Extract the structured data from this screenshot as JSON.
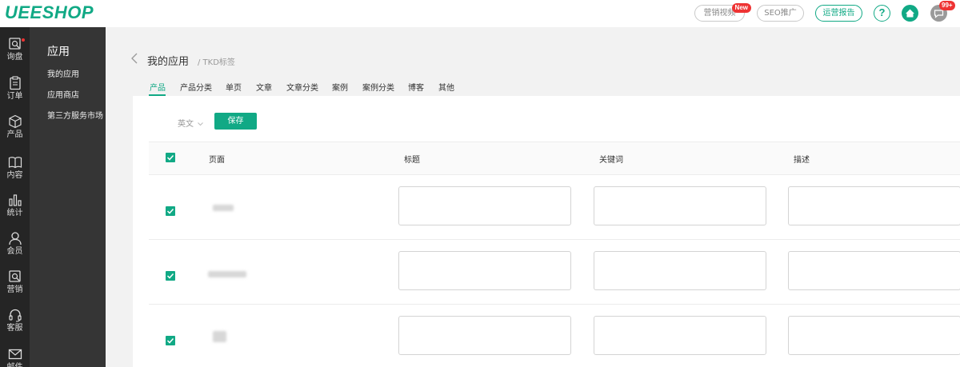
{
  "app": {
    "logo": "UEESHOP"
  },
  "topbar": {
    "marketing_video": "营销视频",
    "new_badge": "New",
    "seo": "SEO推广",
    "ops_report": "运营报告",
    "help": "?",
    "msg_count": "99+"
  },
  "sidebar": {
    "items": [
      {
        "label": "询盘",
        "icon": "inquiry-icon"
      },
      {
        "label": "订单",
        "icon": "order-icon"
      },
      {
        "label": "产品",
        "icon": "product-cube-icon"
      },
      {
        "label": "内容",
        "icon": "content-book-icon"
      },
      {
        "label": "统计",
        "icon": "stats-bar-icon"
      },
      {
        "label": "会员",
        "icon": "member-person-icon"
      },
      {
        "label": "营销",
        "icon": "marketing-icon"
      },
      {
        "label": "客服",
        "icon": "headset-icon"
      },
      {
        "label": "邮件",
        "icon": "mail-icon"
      }
    ]
  },
  "subnav": {
    "title": "应用",
    "items": [
      "我的应用",
      "应用商店",
      "第三方服务市场"
    ]
  },
  "page": {
    "title": "我的应用",
    "breadcrumb": "/ TKD标签"
  },
  "tabs": [
    "产品",
    "产品分类",
    "单页",
    "文章",
    "文章分类",
    "案例",
    "案例分类",
    "博客",
    "其他"
  ],
  "toolbar": {
    "language": "英文",
    "save_label": "保存"
  },
  "table": {
    "headers": [
      "页面",
      "标题",
      "关键词",
      "描述"
    ]
  },
  "colors": {
    "accent": "#11a985",
    "badge": "#ee3333"
  }
}
